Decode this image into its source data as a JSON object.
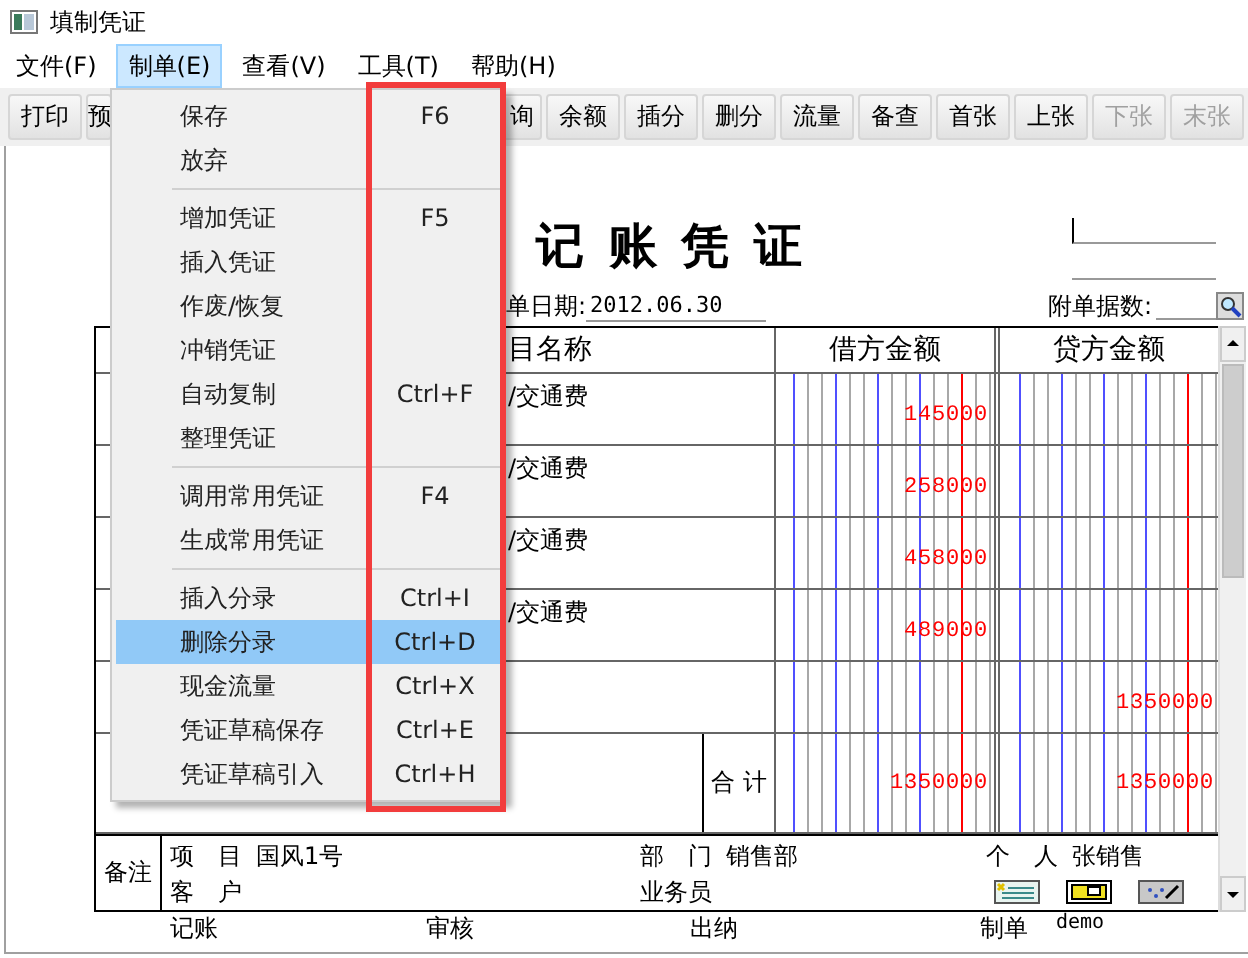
{
  "window": {
    "title": "填制凭证"
  },
  "menu_bar": [
    {
      "label": "文件(F)",
      "selected": false
    },
    {
      "label": "制单(E)",
      "selected": true
    },
    {
      "label": "查看(V)",
      "selected": false
    },
    {
      "label": "工具(T)",
      "selected": false
    },
    {
      "label": "帮助(H)",
      "selected": false
    }
  ],
  "toolbar": {
    "left": [
      {
        "label": "打印",
        "disabled": false
      },
      {
        "label": "预",
        "disabled": false
      }
    ],
    "right": [
      {
        "label": "询",
        "disabled": false
      },
      {
        "label": "余额",
        "disabled": false
      },
      {
        "label": "插分",
        "disabled": false
      },
      {
        "label": "删分",
        "disabled": false
      },
      {
        "label": "流量",
        "disabled": false
      },
      {
        "label": "备查",
        "disabled": false
      },
      {
        "label": "首张",
        "disabled": false
      },
      {
        "label": "上张",
        "disabled": false
      },
      {
        "label": "下张",
        "disabled": true
      },
      {
        "label": "末张",
        "disabled": true
      }
    ]
  },
  "dropdown": [
    {
      "kind": "item",
      "label": "保存",
      "shortcut": "F6",
      "selected": false
    },
    {
      "kind": "item",
      "label": "放弃",
      "selected": false
    },
    {
      "kind": "separator"
    },
    {
      "kind": "item",
      "label": "增加凭证",
      "shortcut": "F5",
      "selected": false
    },
    {
      "kind": "item",
      "label": "插入凭证",
      "selected": false
    },
    {
      "kind": "item",
      "label": "作废/恢复",
      "selected": false
    },
    {
      "kind": "item",
      "label": "冲销凭证",
      "selected": false
    },
    {
      "kind": "item",
      "label": "自动复制",
      "shortcut": "Ctrl+F",
      "selected": false
    },
    {
      "kind": "item",
      "label": "整理凭证",
      "selected": false
    },
    {
      "kind": "separator"
    },
    {
      "kind": "item",
      "label": "调用常用凭证",
      "shortcut": "F4",
      "selected": false
    },
    {
      "kind": "item",
      "label": "生成常用凭证",
      "selected": false
    },
    {
      "kind": "separator"
    },
    {
      "kind": "item",
      "label": "插入分录",
      "shortcut": "Ctrl+I",
      "selected": false
    },
    {
      "kind": "item",
      "label": "删除分录",
      "shortcut": "Ctrl+D",
      "selected": true
    },
    {
      "kind": "item",
      "label": "现金流量",
      "shortcut": "Ctrl+X",
      "selected": false
    },
    {
      "kind": "item",
      "label": "凭证草稿保存",
      "shortcut": "Ctrl+E",
      "selected": false
    },
    {
      "kind": "item",
      "label": "凭证草稿引入",
      "shortcut": "Ctrl+H",
      "selected": false
    }
  ],
  "voucher": {
    "title": "记 账 凭 证",
    "date_label": "单日期:",
    "date": "2012.06.30",
    "attachments_label": "附单据数:",
    "columns": {
      "subject": "目名称",
      "debit": "借方金额",
      "credit": "贷方金额"
    },
    "rows": [
      {
        "subject": "/交通费",
        "debit": "145000"
      },
      {
        "subject": "/交通费",
        "debit": "258000"
      },
      {
        "subject": "/交通费",
        "debit": "458000"
      },
      {
        "subject": "/交通费",
        "debit": "489000"
      },
      {
        "credit": "1350000"
      }
    ],
    "total": {
      "label": "合 计",
      "debit": "1350000",
      "credit": "1350000"
    },
    "remarks": {
      "label": "备注",
      "project_label": "项　目",
      "project": "国风1号",
      "customer_label": "客　户",
      "department_label": "部　门",
      "department": "销售部",
      "salesman_label": "业务员",
      "person_label": "个　人",
      "person": "张销售"
    },
    "signatures": [
      {
        "label": "记账"
      },
      {
        "label": "审核"
      },
      {
        "label": "出纳"
      },
      {
        "label": "制单",
        "value": "demo"
      }
    ]
  }
}
